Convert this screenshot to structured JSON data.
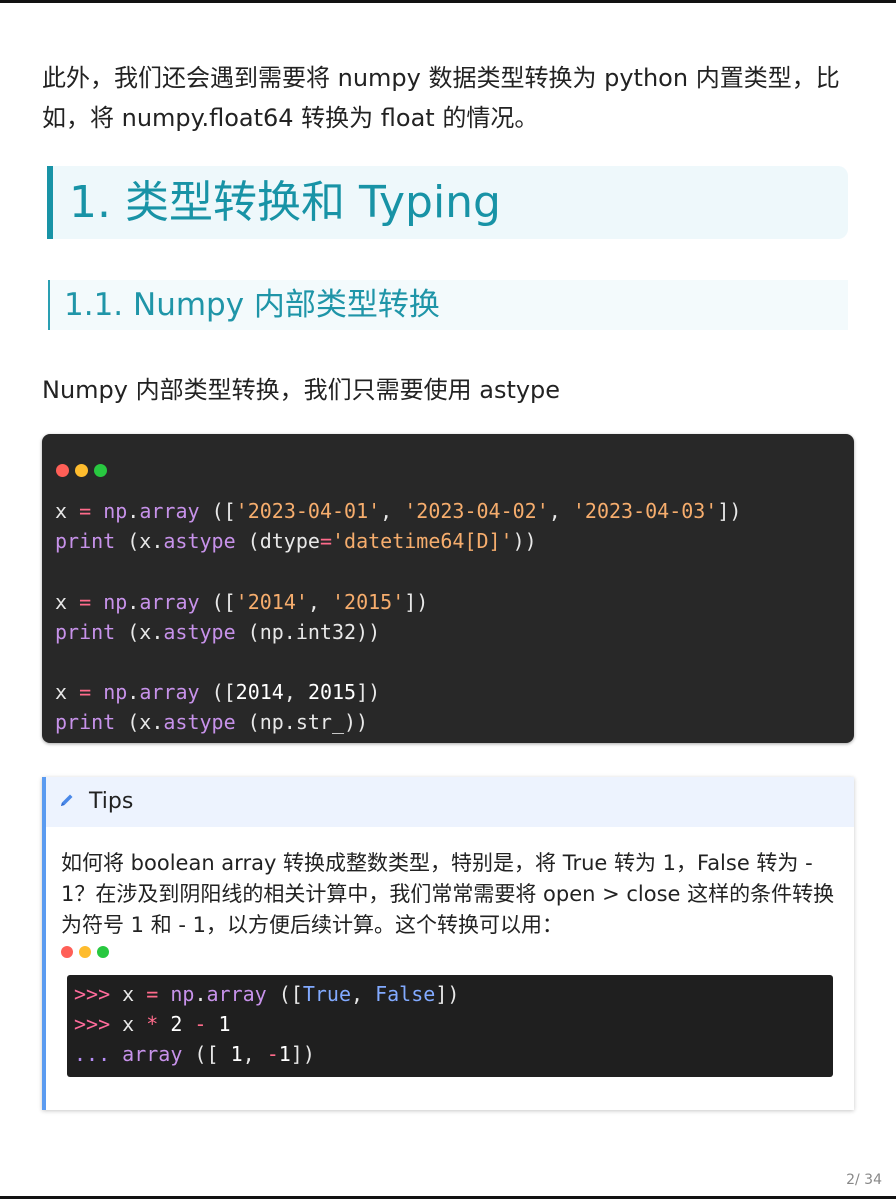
{
  "intro": "此外，我们还会遇到需要将 numpy 数据类型转换为 python 内置类型，比如，将 numpy.float64 转换为 float 的情况。",
  "heading1": "1. 类型转换和 Typing",
  "heading2": "1.1. Numpy 内部类型转换",
  "paragraph": "Numpy 内部类型转换，我们只需要使用 astype",
  "window_dot_colors": [
    "#ff5f57",
    "#febc2e",
    "#28c840"
  ],
  "code_block": [
    [
      {
        "t": "x",
        "c": "pl"
      },
      {
        "t": " ",
        "c": "pl"
      },
      {
        "t": "=",
        "c": "op"
      },
      {
        "t": " ",
        "c": "pl"
      },
      {
        "t": "np",
        "c": "kw"
      },
      {
        "t": ".",
        "c": "pl"
      },
      {
        "t": "array",
        "c": "kw"
      },
      {
        "t": " ([",
        "c": "pl"
      },
      {
        "t": "'2023-04-01'",
        "c": "str"
      },
      {
        "t": ", ",
        "c": "pl"
      },
      {
        "t": "'2023-04-02'",
        "c": "str"
      },
      {
        "t": ", ",
        "c": "pl"
      },
      {
        "t": "'2023-04-03'",
        "c": "str"
      },
      {
        "t": "])",
        "c": "pl"
      }
    ],
    [
      {
        "t": "print",
        "c": "kw"
      },
      {
        "t": " (x.",
        "c": "pl"
      },
      {
        "t": "astype",
        "c": "kw"
      },
      {
        "t": " (dtype",
        "c": "pl"
      },
      {
        "t": "=",
        "c": "op"
      },
      {
        "t": "'datetime64[D]'",
        "c": "str"
      },
      {
        "t": "))",
        "c": "pl"
      }
    ],
    [],
    [
      {
        "t": "x",
        "c": "pl"
      },
      {
        "t": " ",
        "c": "pl"
      },
      {
        "t": "=",
        "c": "op"
      },
      {
        "t": " ",
        "c": "pl"
      },
      {
        "t": "np",
        "c": "kw"
      },
      {
        "t": ".",
        "c": "pl"
      },
      {
        "t": "array",
        "c": "kw"
      },
      {
        "t": " ([",
        "c": "pl"
      },
      {
        "t": "'2014'",
        "c": "str"
      },
      {
        "t": ", ",
        "c": "pl"
      },
      {
        "t": "'2015'",
        "c": "str"
      },
      {
        "t": "])",
        "c": "pl"
      }
    ],
    [
      {
        "t": "print",
        "c": "kw"
      },
      {
        "t": " (x.",
        "c": "pl"
      },
      {
        "t": "astype",
        "c": "kw"
      },
      {
        "t": " (np.int32))",
        "c": "pl"
      }
    ],
    [],
    [
      {
        "t": "x",
        "c": "pl"
      },
      {
        "t": " ",
        "c": "pl"
      },
      {
        "t": "=",
        "c": "op"
      },
      {
        "t": " ",
        "c": "pl"
      },
      {
        "t": "np",
        "c": "kw"
      },
      {
        "t": ".",
        "c": "pl"
      },
      {
        "t": "array",
        "c": "kw"
      },
      {
        "t": " ([",
        "c": "pl"
      },
      {
        "t": "2014",
        "c": "num"
      },
      {
        "t": ", ",
        "c": "pl"
      },
      {
        "t": "2015",
        "c": "num"
      },
      {
        "t": "])",
        "c": "pl"
      }
    ],
    [
      {
        "t": "print",
        "c": "kw"
      },
      {
        "t": " (x.",
        "c": "pl"
      },
      {
        "t": "astype",
        "c": "kw"
      },
      {
        "t": " (np.str_))",
        "c": "pl"
      }
    ]
  ],
  "tips": {
    "title": "Tips",
    "icon": "pencil-icon",
    "body": "如何将 boolean array 转换成整数类型，特别是，将 True 转为 1，False 转为 - 1？在涉及到阴阳线的相关计算中，我们常常需要将 open > close 这样的条件转换为符号 1 和 - 1，以方便后续计算。这个转换可以用：",
    "console": [
      [
        {
          "t": ">>>",
          "c": "prompt"
        },
        {
          "t": " x ",
          "c": "pl"
        },
        {
          "t": "=",
          "c": "op"
        },
        {
          "t": " ",
          "c": "pl"
        },
        {
          "t": "np",
          "c": "kw"
        },
        {
          "t": ".",
          "c": "pl"
        },
        {
          "t": "array",
          "c": "kw"
        },
        {
          "t": " ([",
          "c": "pl"
        },
        {
          "t": "True",
          "c": "bool"
        },
        {
          "t": ", ",
          "c": "pl"
        },
        {
          "t": "False",
          "c": "bool"
        },
        {
          "t": "])",
          "c": "pl"
        }
      ],
      [
        {
          "t": ">>>",
          "c": "prompt"
        },
        {
          "t": " x ",
          "c": "pl"
        },
        {
          "t": "*",
          "c": "op"
        },
        {
          "t": " 2 ",
          "c": "num"
        },
        {
          "t": "-",
          "c": "op"
        },
        {
          "t": " 1",
          "c": "num"
        }
      ],
      [
        {
          "t": "...",
          "c": "pdots"
        },
        {
          "t": " ",
          "c": "pl"
        },
        {
          "t": "array",
          "c": "kw"
        },
        {
          "t": " ([ ",
          "c": "pl"
        },
        {
          "t": "1",
          "c": "num"
        },
        {
          "t": ", ",
          "c": "pl"
        },
        {
          "t": "-",
          "c": "op"
        },
        {
          "t": "1",
          "c": "num"
        },
        {
          "t": "])",
          "c": "pl"
        }
      ]
    ]
  },
  "page_number": "2/ 34"
}
